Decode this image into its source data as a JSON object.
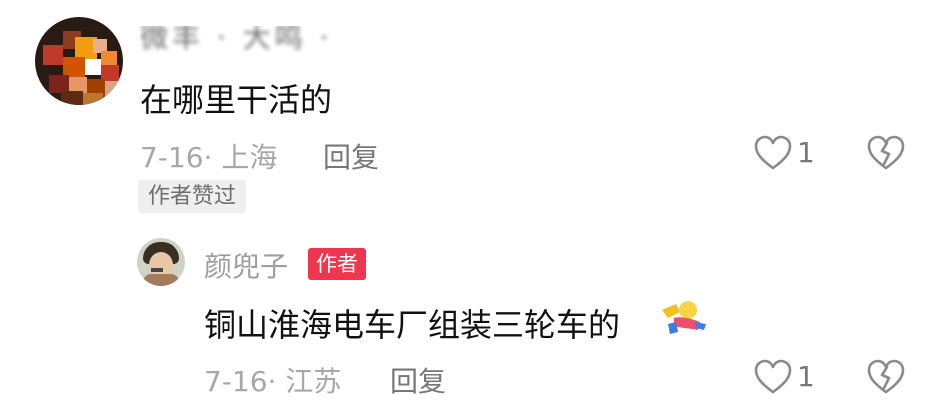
{
  "comment": {
    "username_blurred": "微丰 · 大鸣 ·",
    "text": "在哪里干活的",
    "date": "7-16",
    "location": "上海",
    "reply_label": "回复",
    "likes": "1",
    "author_liked_badge": "作者赞过"
  },
  "reply": {
    "username": "颜兜子",
    "author_badge": "作者",
    "text": "铜山淮海电车厂组装三轮车的",
    "date": "7-16",
    "location": "江苏",
    "reply_label": "回复",
    "likes": "1"
  },
  "icons": {
    "like": "heart-outline-icon",
    "dislike": "broken-heart-icon",
    "emoji": "lying-down-emoji-icon"
  },
  "colors": {
    "author_badge_bg": "#f0364f",
    "meta_text": "#a8a8a8",
    "liked_badge_bg": "#efefef"
  }
}
